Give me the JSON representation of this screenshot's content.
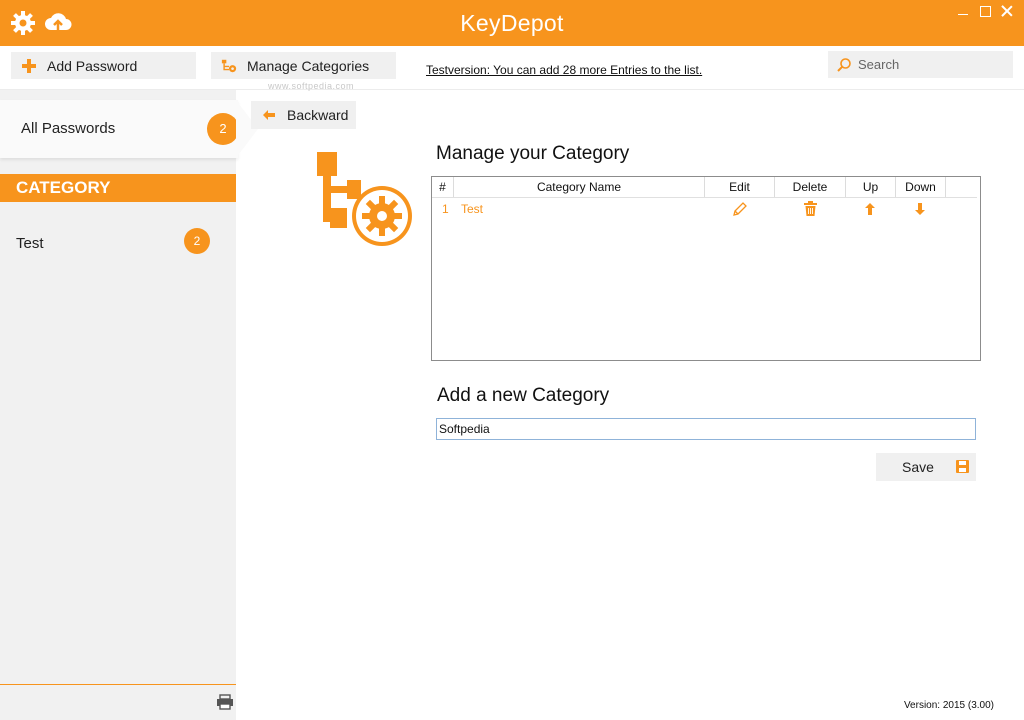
{
  "app": {
    "title": "KeyDepot"
  },
  "titlebar_icons": [
    "gear-icon",
    "cloud-upload-icon"
  ],
  "toolbar": {
    "add_password": "Add Password",
    "manage_categories": "Manage Categories",
    "trial_notice": "Testversion: You can add 28 more Entries to the list.",
    "search_placeholder": "Search"
  },
  "sidebar": {
    "all_passwords": {
      "label": "All Passwords",
      "count": "2"
    },
    "category_header": "CATEGORY",
    "categories": [
      {
        "label": "Test",
        "count": "2"
      }
    ]
  },
  "main": {
    "backward_label": "Backward",
    "manage_heading": "Manage your Category",
    "table": {
      "columns": [
        "#",
        "Category Name",
        "Edit",
        "Delete",
        "Up",
        "Down"
      ],
      "rows": [
        {
          "index": "1",
          "name": "Test"
        }
      ]
    },
    "add_heading": "Add a new Category",
    "new_category_value": "Softpedia",
    "save_label": "Save"
  },
  "footer": {
    "version": "Version:  2015 (3.00)"
  },
  "watermark": "www.softpedia.com",
  "colors": {
    "accent": "#f7941d",
    "sidebar_bg": "#f1f1f1",
    "button_bg": "#f0f0f0"
  }
}
